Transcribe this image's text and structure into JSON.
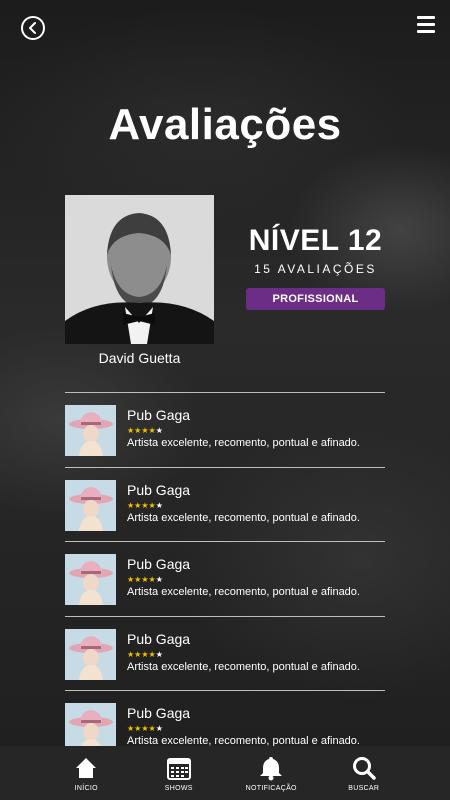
{
  "header": {
    "title": "Avaliações"
  },
  "profile": {
    "artist_name": "David Guetta",
    "level": "NÍVEL 12",
    "reviews_count": "15 AVALIAÇÕES",
    "badge": "PROFISSIONAL"
  },
  "reviews": [
    {
      "venue": "Pub Gaga",
      "rating": 4,
      "max_rating": 5,
      "comment": "Artista excelente, recomento, pontual e afinado."
    },
    {
      "venue": "Pub Gaga",
      "rating": 4,
      "max_rating": 5,
      "comment": "Artista excelente, recomento, pontual e afinado."
    },
    {
      "venue": "Pub Gaga",
      "rating": 4,
      "max_rating": 5,
      "comment": "Artista excelente, recomento, pontual e afinado."
    },
    {
      "venue": "Pub Gaga",
      "rating": 4,
      "max_rating": 5,
      "comment": "Artista excelente, recomento, pontual e afinado."
    },
    {
      "venue": "Pub Gaga",
      "rating": 4,
      "max_rating": 5,
      "comment": "Artista excelente, recomento, pontual e afinado."
    }
  ],
  "tabbar": {
    "home": "INÍCIO",
    "shows": "SHOWS",
    "notifications": "NOTIFICAÇÃO",
    "search": "BUSCAR"
  },
  "colors": {
    "badge": "#6b2d86",
    "star_active": "#f2c200",
    "tabbar": "#262626"
  },
  "icons": [
    "back-icon",
    "menu-icon",
    "home-icon",
    "calendar-icon",
    "bell-icon",
    "search-icon"
  ]
}
